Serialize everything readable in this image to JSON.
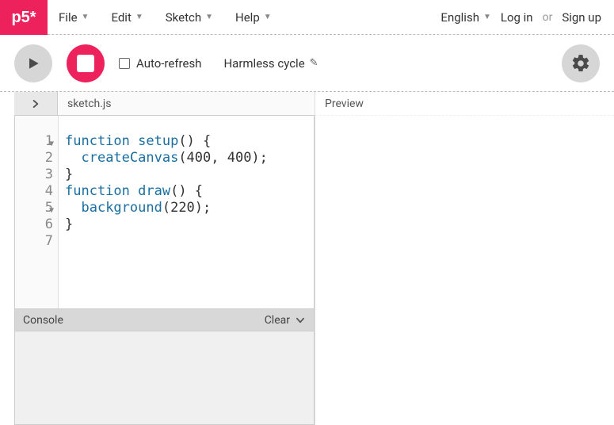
{
  "logo": "p5*",
  "menu": {
    "file": "File",
    "edit": "Edit",
    "sketch": "Sketch",
    "help": "Help",
    "language": "English",
    "login": "Log in",
    "or": "or",
    "signup": "Sign up"
  },
  "toolbar": {
    "auto_refresh": "Auto-refresh",
    "sketch_name": "Harmless cycle"
  },
  "tabs": {
    "filename": "sketch.js",
    "preview": "Preview"
  },
  "code": {
    "lines": [
      "1",
      "2",
      "3",
      "4",
      "5",
      "6",
      "7"
    ],
    "l1a": "function",
    "l1b": " ",
    "l1c": "setup",
    "l1d": "() {",
    "l2a": "  ",
    "l2b": "createCanvas",
    "l2c": "(400, 400);",
    "l3": "}",
    "l4": "",
    "l5a": "function",
    "l5b": " ",
    "l5c": "draw",
    "l5d": "() {",
    "l6a": "  ",
    "l6b": "background",
    "l6c": "(220);",
    "l7": "}"
  },
  "console": {
    "title": "Console",
    "clear": "Clear"
  }
}
